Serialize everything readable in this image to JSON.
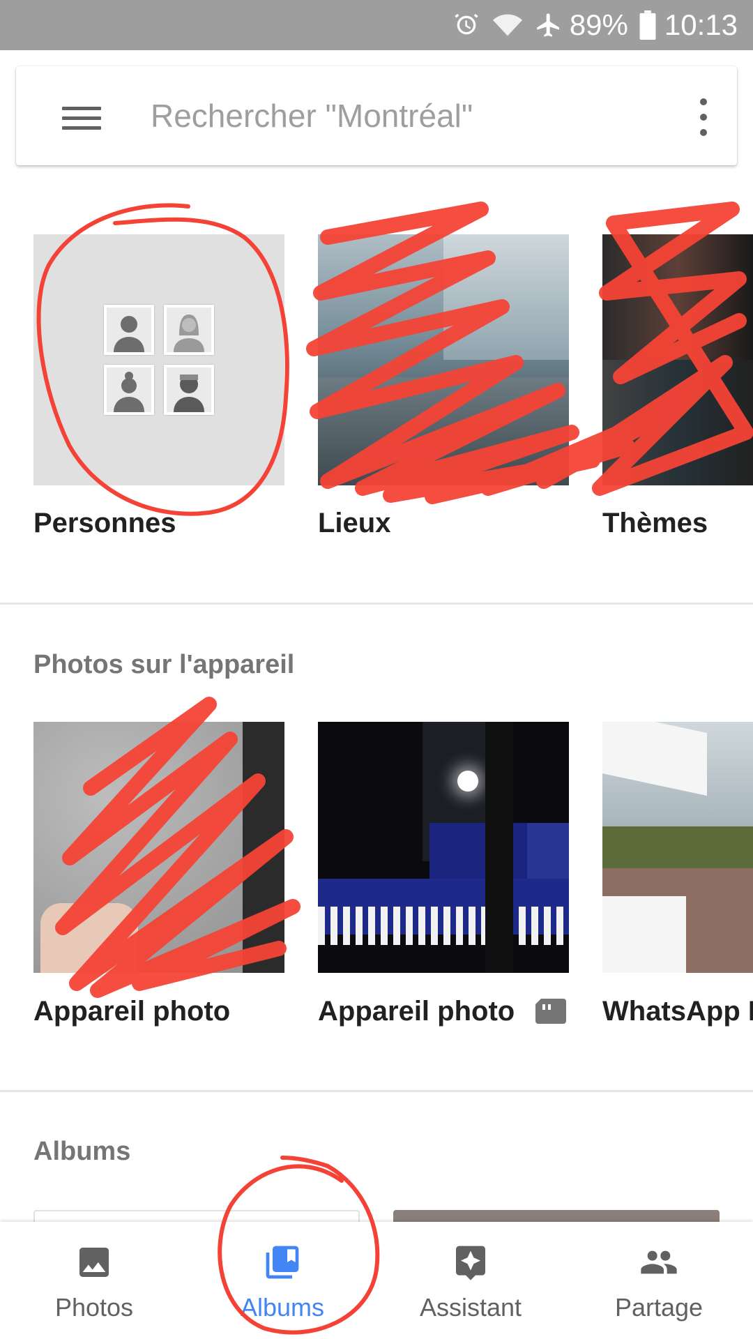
{
  "status_bar": {
    "battery": "89%",
    "time": "10:13",
    "icons": [
      "alarm-icon",
      "wifi-icon",
      "airplane-mode-icon",
      "battery-icon"
    ]
  },
  "search": {
    "placeholder": "Rechercher \"Montréal\""
  },
  "categories": [
    {
      "label": "Personnes"
    },
    {
      "label": "Lieux"
    },
    {
      "label": "Thèmes"
    }
  ],
  "device_section": {
    "title": "Photos sur l'appareil",
    "folders": [
      {
        "label": "Appareil photo"
      },
      {
        "label": "Appareil photo",
        "sd_card": true
      },
      {
        "label": "WhatsApp I"
      }
    ]
  },
  "albums_section": {
    "title": "Albums"
  },
  "bottom_nav": {
    "items": [
      {
        "label": "Photos",
        "icon": "photo-icon"
      },
      {
        "label": "Albums",
        "icon": "albums-icon",
        "active": true
      },
      {
        "label": "Assistant",
        "icon": "assistant-icon"
      },
      {
        "label": "Partage",
        "icon": "people-icon"
      }
    ]
  },
  "colors": {
    "accent": "#4285f4",
    "annotation": "#f44336",
    "status_bar": "#9e9e9e"
  }
}
